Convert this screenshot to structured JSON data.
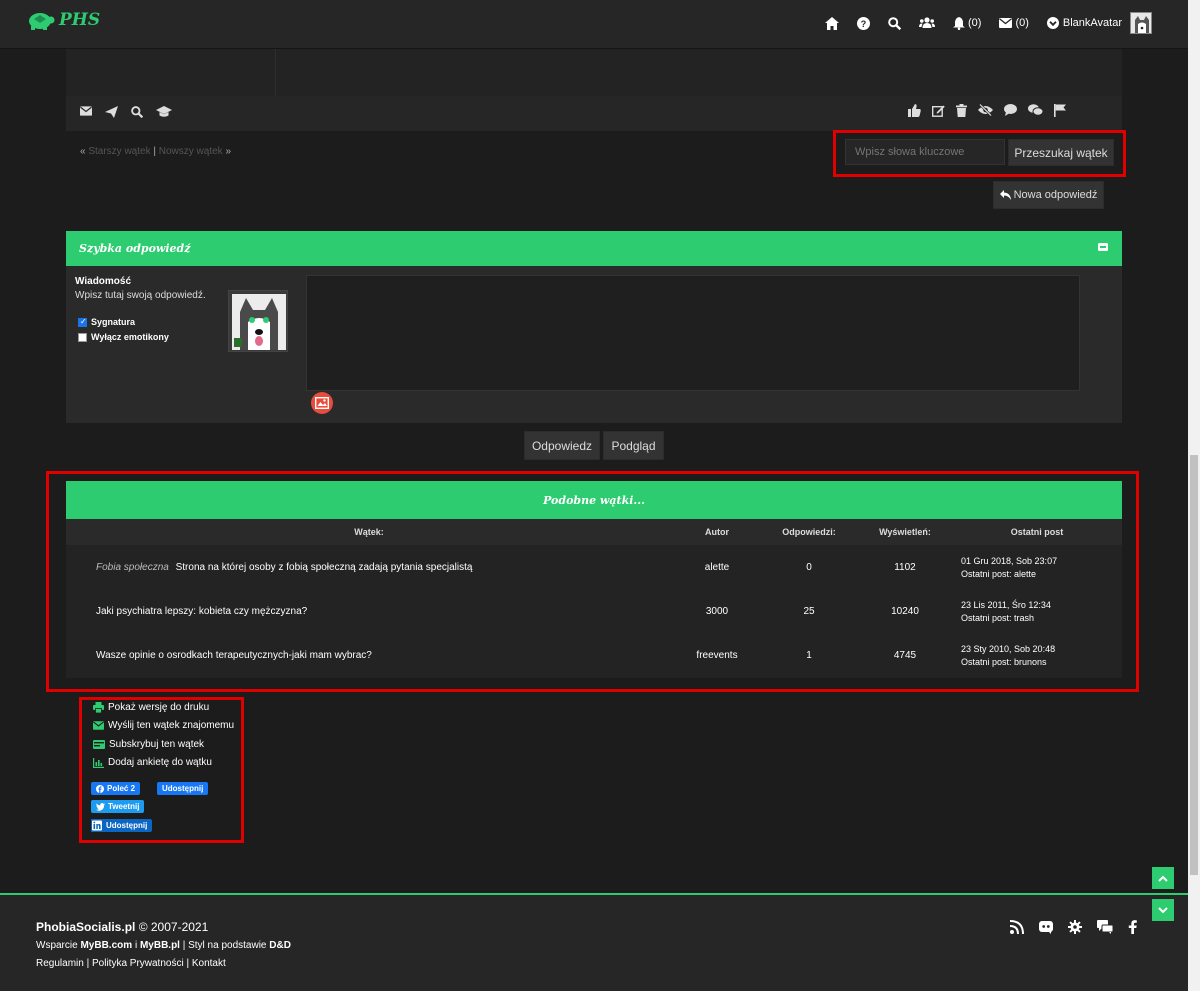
{
  "header": {
    "logo_text": "PHS",
    "notifications_count": "(0)",
    "messages_count": "(0)",
    "username": "BlankAvatar"
  },
  "thread_nav": {
    "prefix": "«",
    "older": "Starszy wątek",
    "separator": "|",
    "newer": "Nowszy wątek",
    "suffix": "»"
  },
  "thread_search": {
    "placeholder": "Wpisz słowa kluczowe",
    "button": "Przeszukaj wątek"
  },
  "new_reply_button": "Nowa odpowiedź",
  "quick_reply": {
    "title": "Szybka odpowiedź",
    "message_label": "Wiadomość",
    "message_hint": "Wpisz tutaj swoją odpowiedź.",
    "signature_label": "Sygnatura",
    "signature_checked": true,
    "disable_smilies_label": "Wyłącz emotikony",
    "disable_smilies_checked": false,
    "reply_button": "Odpowiedz",
    "preview_button": "Podgląd"
  },
  "similar_threads": {
    "title": "Podobne wątki...",
    "columns": [
      "Wątek:",
      "Autor",
      "Odpowiedzi:",
      "Wyświetleń:",
      "Ostatni post"
    ],
    "rows": [
      {
        "prefix": "Fobia społeczna",
        "title": "Strona na której osoby z fobią społeczną zadają pytania specjalistą",
        "author": "alette",
        "replies": "0",
        "views": "1102",
        "last_date": "01 Gru 2018, Sob 23:07",
        "last_post": "Ostatni post: alette"
      },
      {
        "prefix": "",
        "title": "Jaki psychiatra lepszy: kobieta czy mężczyzna?",
        "author": "3000",
        "replies": "25",
        "views": "10240",
        "last_date": "23 Lis 2011, Śro 12:34",
        "last_post": "Ostatni post: trash"
      },
      {
        "prefix": "",
        "title": "Wasze opinie o osrodkach terapeutycznych-jaki mam wybrac?",
        "author": "freevents",
        "replies": "1",
        "views": "4745",
        "last_date": "23 Sty 2010, Sob 20:48",
        "last_post": "Ostatni post: brunons"
      }
    ]
  },
  "thread_tools": {
    "print": "Pokaż wersję do druku",
    "send_friend": "Wyślij ten wątek znajomemu",
    "subscribe": "Subskrybuj ten wątek",
    "add_poll": "Dodaj ankietę do wątku"
  },
  "share": {
    "fb_like": "Poleć 2",
    "fb_share": "Udostępnij",
    "tweet": "Tweetnij",
    "linkedin": "Udostępnij"
  },
  "footer": {
    "site": "PhobiaSocialis.pl",
    "copyright": "© 2007-2021",
    "support_prefix": "Wsparcie",
    "mybb_com": "MyBB.com",
    "and": "i",
    "mybb_pl": "MyBB.pl",
    "style_prefix": "| Styl na podstawie",
    "dnd": "D&D",
    "rules": "Regulamin",
    "privacy": "Polityka Prywatności",
    "contact": "Kontakt",
    "sep": "|"
  },
  "colors": {
    "accent": "#2ecc71",
    "highlight": "#e00000",
    "background": "#1c1c1c"
  }
}
